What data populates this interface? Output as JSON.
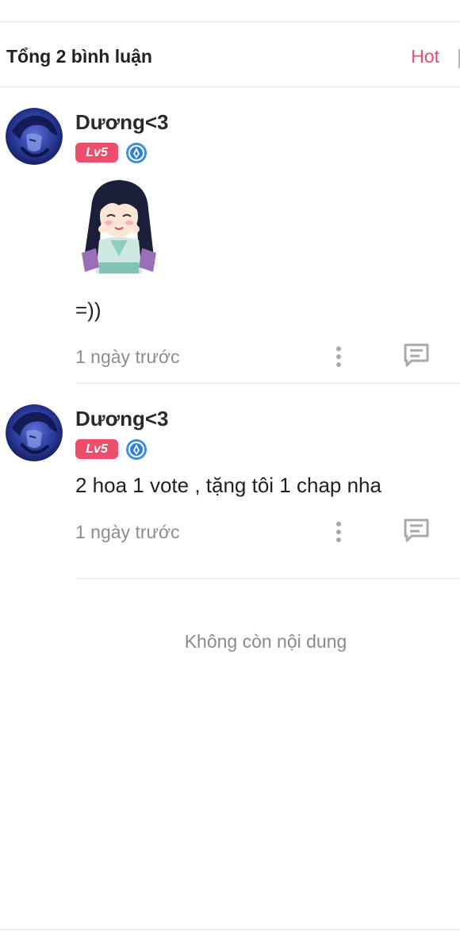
{
  "header": {
    "comment_count": "Tổng 2 bình luận",
    "sort_label": "Hot"
  },
  "comments": [
    {
      "username": "Dương<3",
      "level": "Lv5",
      "text": "=))",
      "has_sticker": true,
      "time": "1 ngày trước"
    },
    {
      "username": "Dương<3",
      "level": "Lv5",
      "text": "2 hoa 1 vote , tặng tôi 1 chap nha",
      "has_sticker": false,
      "time": "1 ngày trước"
    }
  ],
  "footer": {
    "end_message": "Không còn nội dung"
  },
  "colors": {
    "accent": "#ec4f6c",
    "hot": "#e0506b",
    "muted": "#8c8c8c"
  }
}
